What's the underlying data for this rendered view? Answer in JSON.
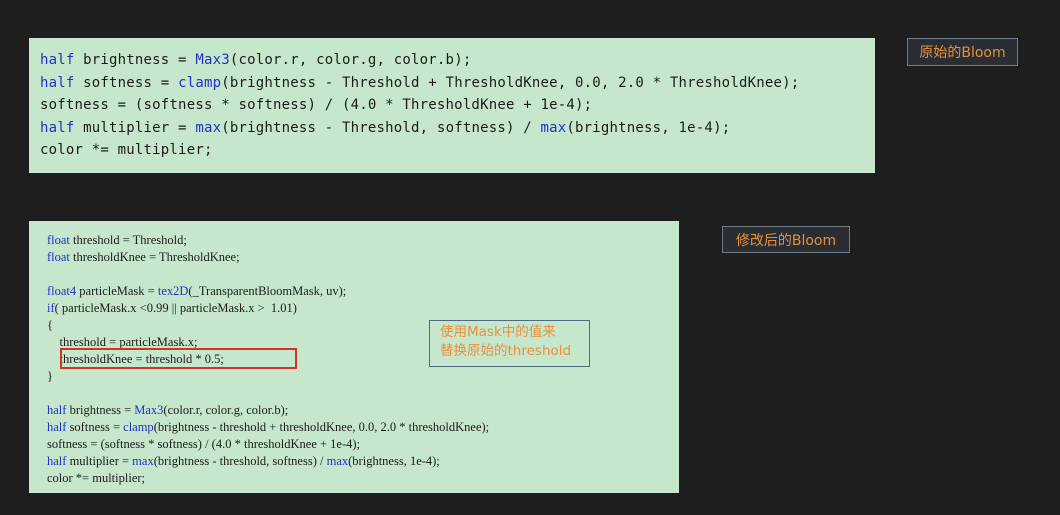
{
  "labels": {
    "original": "原始的Bloom",
    "modified": "修改后的Bloom"
  },
  "callout": {
    "line1": "使用Mask中的值来",
    "line2": "替换原始的threshold"
  },
  "original_code": [
    [
      {
        "t": "half",
        "c": "kw"
      },
      {
        "t": " brightness = "
      },
      {
        "t": "Max3",
        "c": "fn"
      },
      {
        "t": "(color.r, color.g, color.b);"
      }
    ],
    [
      {
        "t": "half",
        "c": "kw"
      },
      {
        "t": " softness = "
      },
      {
        "t": "clamp",
        "c": "fn"
      },
      {
        "t": "(brightness - Threshold + ThresholdKnee, 0.0, 2.0 * ThresholdKnee);"
      }
    ],
    [
      {
        "t": "softness = (softness * softness) / (4.0 * ThresholdKnee + 1e-4);"
      }
    ],
    [
      {
        "t": "half",
        "c": "kw"
      },
      {
        "t": " multiplier = "
      },
      {
        "t": "max",
        "c": "fn"
      },
      {
        "t": "(brightness - Threshold, softness) / "
      },
      {
        "t": "max",
        "c": "fn"
      },
      {
        "t": "(brightness, 1e-4);"
      }
    ],
    [
      {
        "t": "color *= multiplier;"
      }
    ]
  ],
  "modified_code": [
    [
      {
        "t": "float",
        "c": "kw"
      },
      {
        "t": " threshold = Threshold;"
      }
    ],
    [
      {
        "t": "float",
        "c": "kw"
      },
      {
        "t": " thresholdKnee = ThresholdKnee;"
      }
    ],
    [
      {
        "t": ""
      }
    ],
    [
      {
        "t": "float4",
        "c": "kw"
      },
      {
        "t": " particleMask = "
      },
      {
        "t": "tex2D",
        "c": "fn"
      },
      {
        "t": "(_TransparentBloomMask, uv);"
      }
    ],
    [
      {
        "t": "if",
        "c": "kw"
      },
      {
        "t": "( particleMask.x <0.99 || particleMask.x >  1.01)"
      }
    ],
    [
      {
        "t": "{"
      }
    ],
    [
      {
        "t": "    threshold = particleMask.x;"
      }
    ],
    [
      {
        "t": "    thresholdKnee = threshold * 0.5;"
      }
    ],
    [
      {
        "t": "}"
      }
    ],
    [
      {
        "t": ""
      }
    ],
    [
      {
        "t": "half",
        "c": "kw"
      },
      {
        "t": " brightness = "
      },
      {
        "t": "Max3",
        "c": "fn"
      },
      {
        "t": "(color.r, color.g, color.b);"
      }
    ],
    [
      {
        "t": "half",
        "c": "kw"
      },
      {
        "t": " softness = "
      },
      {
        "t": "clamp",
        "c": "fn"
      },
      {
        "t": "(brightness - threshold + thresholdKnee, 0.0, 2.0 * thresholdKnee);"
      }
    ],
    [
      {
        "t": "softness = (softness * softness) / (4.0 * thresholdKnee + 1e-4);"
      }
    ],
    [
      {
        "t": "half",
        "c": "kw"
      },
      {
        "t": " multiplier = "
      },
      {
        "t": "max",
        "c": "fn"
      },
      {
        "t": "(brightness - threshold, softness) / "
      },
      {
        "t": "max",
        "c": "fn"
      },
      {
        "t": "(brightness, 1e-4);"
      }
    ],
    [
      {
        "t": "color *= multiplier;"
      }
    ]
  ]
}
